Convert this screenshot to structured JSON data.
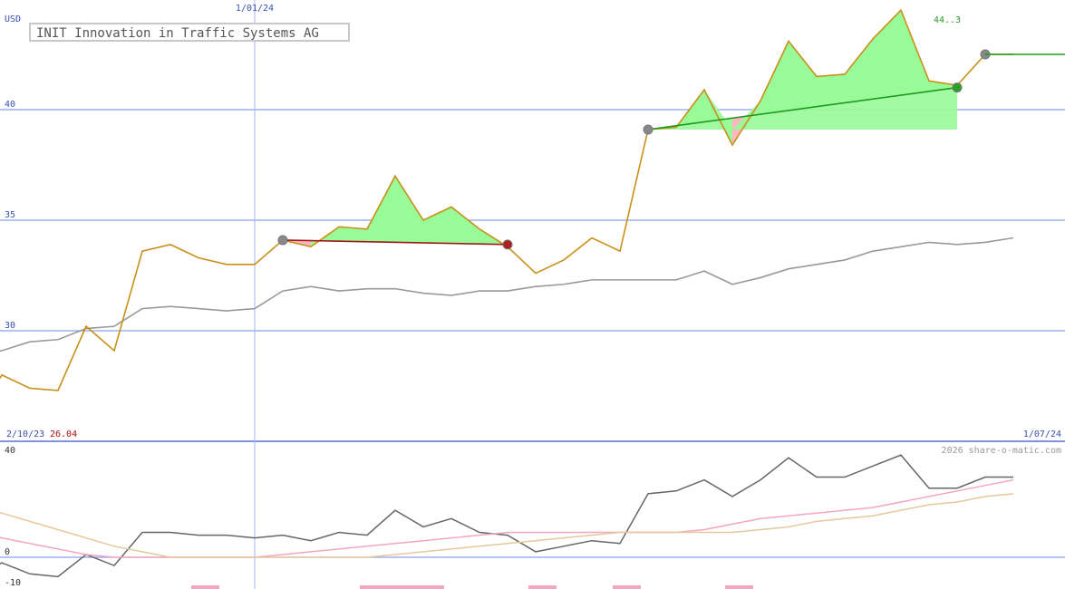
{
  "title": "INIT Innovation in Traffic Systems AG",
  "currency": "USD",
  "copyright": "2026 share-o-matic.com",
  "date_top": "1/01/24",
  "date_start": "2/10/23",
  "date_end": "1/07/24",
  "start_value": "26.04",
  "peak_label": "44..3",
  "colors": {
    "price": "#c8901a",
    "benchmark": "#999999",
    "gridline": "#8c9fe6",
    "axis_text": "#3a4fb5",
    "gain_fill": "#98fb98",
    "loss_fill": "#ffb6c1",
    "trade_loss_line": "#a01818",
    "trade_gain_line": "#1e9a1e",
    "osc_line": "#666666",
    "osc_pink": "#f4a6c0",
    "osc_tan": "#e6c99a",
    "start_value_color": "#b01010",
    "peak_color": "#2a9a2a"
  },
  "chart_data": [
    {
      "type": "line",
      "title": "INIT Innovation in Traffic Systems AG",
      "ylabel": "USD",
      "ylim": [
        25.5,
        45
      ],
      "yticks": [
        30,
        35,
        40
      ],
      "x_ticks": [
        {
          "index": 11,
          "label": "1/01/24"
        }
      ],
      "x": [
        0,
        1,
        2,
        3,
        4,
        5,
        6,
        7,
        8,
        9,
        10,
        11,
        12,
        13,
        14,
        15,
        16,
        17,
        18,
        19,
        20,
        21,
        22,
        23,
        24,
        25,
        26,
        27,
        28,
        29,
        30,
        31,
        32,
        33,
        34,
        35,
        36,
        37,
        38
      ],
      "series": [
        {
          "role": "price",
          "values": [
            26.4,
            26.0,
            28.0,
            27.4,
            27.3,
            30.2,
            29.1,
            33.6,
            33.9,
            33.3,
            33.0,
            33.0,
            34.1,
            33.8,
            34.7,
            34.6,
            37.0,
            35.0,
            35.6,
            34.6,
            33.8,
            32.6,
            33.2,
            34.2,
            33.6,
            39.1,
            39.2,
            40.9,
            38.4,
            40.4,
            43.1,
            41.5,
            41.6,
            43.2,
            44.5,
            41.3,
            41.1,
            42.5,
            42.5
          ]
        },
        {
          "role": "benchmark",
          "values": [
            28.7,
            28.9,
            29.1,
            29.5,
            29.6,
            30.1,
            30.2,
            31.0,
            31.1,
            31.0,
            30.9,
            31.0,
            31.8,
            32.0,
            31.8,
            31.9,
            31.9,
            31.7,
            31.6,
            31.8,
            31.8,
            32.0,
            32.1,
            32.3,
            32.3,
            32.3,
            32.3,
            32.7,
            32.1,
            32.4,
            32.8,
            33.0,
            33.2,
            33.6,
            33.8,
            34.0,
            33.9,
            34.0,
            34.2
          ]
        }
      ],
      "trades": [
        {
          "start_index": 12,
          "start_value": 34.1,
          "end_index": 20,
          "end_value": 33.9,
          "result": "loss"
        },
        {
          "start_index": 25,
          "start_value": 39.1,
          "end_index": 36,
          "end_value": 41.0,
          "result": "gain"
        }
      ]
    },
    {
      "type": "line",
      "ylim": [
        -11,
        42
      ],
      "yticks": [
        -10,
        0,
        40
      ],
      "x": [
        0,
        1,
        2,
        3,
        4,
        5,
        6,
        7,
        8,
        9,
        10,
        11,
        12,
        13,
        14,
        15,
        16,
        17,
        18,
        19,
        20,
        21,
        22,
        23,
        24,
        25,
        26,
        27,
        28,
        29,
        30,
        31,
        32,
        33,
        34,
        35,
        36,
        37,
        38
      ],
      "series": [
        {
          "role": "oscillator",
          "values": [
            -6,
            -8,
            -2,
            -6,
            -7,
            1,
            -3,
            9,
            9,
            8,
            8,
            7,
            8,
            6,
            9,
            8,
            17,
            11,
            14,
            9,
            8,
            2,
            4,
            6,
            5,
            23,
            24,
            28,
            22,
            28,
            36,
            29,
            29,
            33,
            37,
            25,
            25,
            29,
            29
          ]
        },
        {
          "role": "slow-pink",
          "values": [
            13,
            10,
            7,
            5,
            3,
            1,
            0,
            0,
            0,
            0,
            0,
            0,
            1,
            2,
            3,
            4,
            5,
            6,
            7,
            8,
            9,
            9,
            9,
            9,
            9,
            9,
            9,
            10,
            12,
            14,
            15,
            16,
            17,
            18,
            20,
            22,
            24,
            26,
            28
          ]
        },
        {
          "role": "slow-tan",
          "values": [
            19,
            18,
            16,
            13,
            10,
            7,
            4,
            2,
            0,
            0,
            0,
            0,
            0,
            0,
            0,
            0,
            1,
            2,
            3,
            4,
            5,
            6,
            7,
            8,
            9,
            9,
            9,
            9,
            9,
            10,
            11,
            13,
            14,
            15,
            17,
            19,
            20,
            22,
            23
          ]
        }
      ]
    }
  ]
}
